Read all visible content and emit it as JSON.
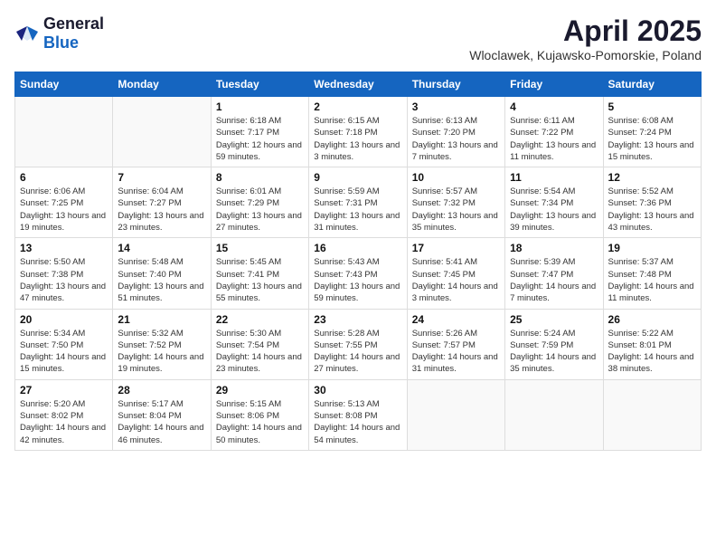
{
  "header": {
    "logo_general": "General",
    "logo_blue": "Blue",
    "title": "April 2025",
    "subtitle": "Wloclawek, Kujawsko-Pomorskie, Poland"
  },
  "days_of_week": [
    "Sunday",
    "Monday",
    "Tuesday",
    "Wednesday",
    "Thursday",
    "Friday",
    "Saturday"
  ],
  "weeks": [
    [
      {
        "day": "",
        "info": ""
      },
      {
        "day": "",
        "info": ""
      },
      {
        "day": "1",
        "info": "Sunrise: 6:18 AM\nSunset: 7:17 PM\nDaylight: 12 hours and 59 minutes."
      },
      {
        "day": "2",
        "info": "Sunrise: 6:15 AM\nSunset: 7:18 PM\nDaylight: 13 hours and 3 minutes."
      },
      {
        "day": "3",
        "info": "Sunrise: 6:13 AM\nSunset: 7:20 PM\nDaylight: 13 hours and 7 minutes."
      },
      {
        "day": "4",
        "info": "Sunrise: 6:11 AM\nSunset: 7:22 PM\nDaylight: 13 hours and 11 minutes."
      },
      {
        "day": "5",
        "info": "Sunrise: 6:08 AM\nSunset: 7:24 PM\nDaylight: 13 hours and 15 minutes."
      }
    ],
    [
      {
        "day": "6",
        "info": "Sunrise: 6:06 AM\nSunset: 7:25 PM\nDaylight: 13 hours and 19 minutes."
      },
      {
        "day": "7",
        "info": "Sunrise: 6:04 AM\nSunset: 7:27 PM\nDaylight: 13 hours and 23 minutes."
      },
      {
        "day": "8",
        "info": "Sunrise: 6:01 AM\nSunset: 7:29 PM\nDaylight: 13 hours and 27 minutes."
      },
      {
        "day": "9",
        "info": "Sunrise: 5:59 AM\nSunset: 7:31 PM\nDaylight: 13 hours and 31 minutes."
      },
      {
        "day": "10",
        "info": "Sunrise: 5:57 AM\nSunset: 7:32 PM\nDaylight: 13 hours and 35 minutes."
      },
      {
        "day": "11",
        "info": "Sunrise: 5:54 AM\nSunset: 7:34 PM\nDaylight: 13 hours and 39 minutes."
      },
      {
        "day": "12",
        "info": "Sunrise: 5:52 AM\nSunset: 7:36 PM\nDaylight: 13 hours and 43 minutes."
      }
    ],
    [
      {
        "day": "13",
        "info": "Sunrise: 5:50 AM\nSunset: 7:38 PM\nDaylight: 13 hours and 47 minutes."
      },
      {
        "day": "14",
        "info": "Sunrise: 5:48 AM\nSunset: 7:40 PM\nDaylight: 13 hours and 51 minutes."
      },
      {
        "day": "15",
        "info": "Sunrise: 5:45 AM\nSunset: 7:41 PM\nDaylight: 13 hours and 55 minutes."
      },
      {
        "day": "16",
        "info": "Sunrise: 5:43 AM\nSunset: 7:43 PM\nDaylight: 13 hours and 59 minutes."
      },
      {
        "day": "17",
        "info": "Sunrise: 5:41 AM\nSunset: 7:45 PM\nDaylight: 14 hours and 3 minutes."
      },
      {
        "day": "18",
        "info": "Sunrise: 5:39 AM\nSunset: 7:47 PM\nDaylight: 14 hours and 7 minutes."
      },
      {
        "day": "19",
        "info": "Sunrise: 5:37 AM\nSunset: 7:48 PM\nDaylight: 14 hours and 11 minutes."
      }
    ],
    [
      {
        "day": "20",
        "info": "Sunrise: 5:34 AM\nSunset: 7:50 PM\nDaylight: 14 hours and 15 minutes."
      },
      {
        "day": "21",
        "info": "Sunrise: 5:32 AM\nSunset: 7:52 PM\nDaylight: 14 hours and 19 minutes."
      },
      {
        "day": "22",
        "info": "Sunrise: 5:30 AM\nSunset: 7:54 PM\nDaylight: 14 hours and 23 minutes."
      },
      {
        "day": "23",
        "info": "Sunrise: 5:28 AM\nSunset: 7:55 PM\nDaylight: 14 hours and 27 minutes."
      },
      {
        "day": "24",
        "info": "Sunrise: 5:26 AM\nSunset: 7:57 PM\nDaylight: 14 hours and 31 minutes."
      },
      {
        "day": "25",
        "info": "Sunrise: 5:24 AM\nSunset: 7:59 PM\nDaylight: 14 hours and 35 minutes."
      },
      {
        "day": "26",
        "info": "Sunrise: 5:22 AM\nSunset: 8:01 PM\nDaylight: 14 hours and 38 minutes."
      }
    ],
    [
      {
        "day": "27",
        "info": "Sunrise: 5:20 AM\nSunset: 8:02 PM\nDaylight: 14 hours and 42 minutes."
      },
      {
        "day": "28",
        "info": "Sunrise: 5:17 AM\nSunset: 8:04 PM\nDaylight: 14 hours and 46 minutes."
      },
      {
        "day": "29",
        "info": "Sunrise: 5:15 AM\nSunset: 8:06 PM\nDaylight: 14 hours and 50 minutes."
      },
      {
        "day": "30",
        "info": "Sunrise: 5:13 AM\nSunset: 8:08 PM\nDaylight: 14 hours and 54 minutes."
      },
      {
        "day": "",
        "info": ""
      },
      {
        "day": "",
        "info": ""
      },
      {
        "day": "",
        "info": ""
      }
    ]
  ]
}
